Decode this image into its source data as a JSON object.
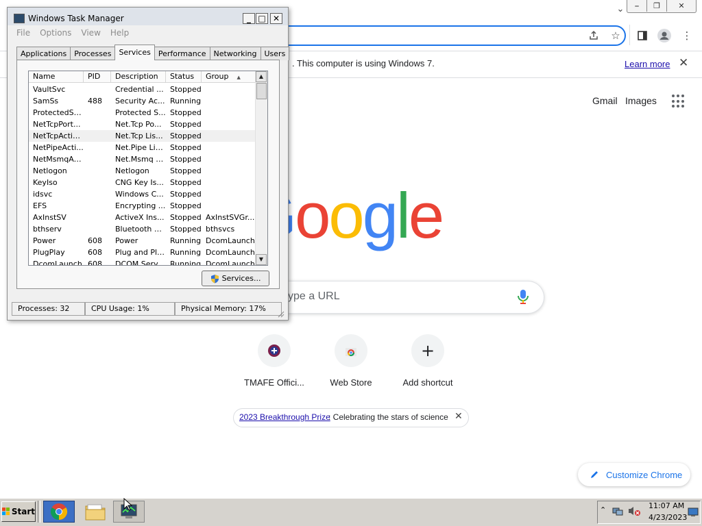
{
  "chrome": {
    "window_controls": {
      "minimize": "⎯",
      "maximize": "❐",
      "close": "✕"
    },
    "infobar": {
      "text": ". This computer is using Windows 7.",
      "learn_more": "Learn more"
    },
    "header_links": {
      "gmail": "Gmail",
      "images": "Images"
    },
    "logo_letters": [
      {
        "ch": "G",
        "color": "#4285f4"
      },
      {
        "ch": "o",
        "color": "#ea4335"
      },
      {
        "ch": "o",
        "color": "#fbbc05"
      },
      {
        "ch": "g",
        "color": "#4285f4"
      },
      {
        "ch": "l",
        "color": "#34a853"
      },
      {
        "ch": "e",
        "color": "#ea4335"
      }
    ],
    "search_placeholder": "ype a URL",
    "shortcuts": [
      {
        "label": "TMAFE Offici..."
      },
      {
        "label": "Web Store"
      },
      {
        "label": "Add shortcut"
      }
    ],
    "promo": {
      "link": "2023 Breakthrough Prize",
      "text": ": Celebrating the stars of science"
    },
    "customize_label": "Customize Chrome"
  },
  "task_manager": {
    "title": "Windows Task Manager",
    "menu": [
      "File",
      "Options",
      "View",
      "Help"
    ],
    "tabs": [
      "Applications",
      "Processes",
      "Services",
      "Performance",
      "Networking",
      "Users"
    ],
    "active_tab": "Services",
    "columns": [
      "Name",
      "PID",
      "Description",
      "Status",
      "Group"
    ],
    "sort_indicator": "▲",
    "rows": [
      [
        "VaultSvc",
        "",
        "Credential ...",
        "Stopped",
        ""
      ],
      [
        "SamSs",
        "488",
        "Security Ac...",
        "Running",
        ""
      ],
      [
        "ProtectedSt...",
        "",
        "Protected S...",
        "Stopped",
        ""
      ],
      [
        "NetTcpPort...",
        "",
        "Net.Tcp Po...",
        "Stopped",
        ""
      ],
      [
        "NetTcpActiv...",
        "",
        "Net.Tcp Lis...",
        "Stopped",
        ""
      ],
      [
        "NetPipeActi...",
        "",
        "Net.Pipe Lis...",
        "Stopped",
        ""
      ],
      [
        "NetMsmqAc...",
        "",
        "Net.Msmq L...",
        "Stopped",
        ""
      ],
      [
        "Netlogon",
        "",
        "Netlogon",
        "Stopped",
        ""
      ],
      [
        "KeyIso",
        "",
        "CNG Key Is...",
        "Stopped",
        ""
      ],
      [
        "idsvc",
        "",
        "Windows C...",
        "Stopped",
        ""
      ],
      [
        "EFS",
        "",
        "Encrypting ...",
        "Stopped",
        ""
      ],
      [
        "AxInstSV",
        "",
        "ActiveX Ins...",
        "Stopped",
        "AxInstSVGr..."
      ],
      [
        "bthserv",
        "",
        "Bluetooth S...",
        "Stopped",
        "bthsvcs"
      ],
      [
        "Power",
        "608",
        "Power",
        "Running",
        "DcomLaunch"
      ],
      [
        "PlugPlay",
        "608",
        "Plug and Play",
        "Running",
        "DcomLaunch"
      ],
      [
        "DcomLaunch",
        "608",
        "DCOM Serv...",
        "Running",
        "DcomLaunch"
      ]
    ],
    "selected_row_index": 4,
    "services_button": "Services...",
    "status": {
      "processes": "Processes: 32",
      "cpu": "CPU Usage: 1%",
      "memory": "Physical Memory: 17%"
    }
  },
  "taskbar": {
    "start_label": "Start",
    "clock_time": "11:07 AM",
    "clock_date": "4/23/2023"
  }
}
